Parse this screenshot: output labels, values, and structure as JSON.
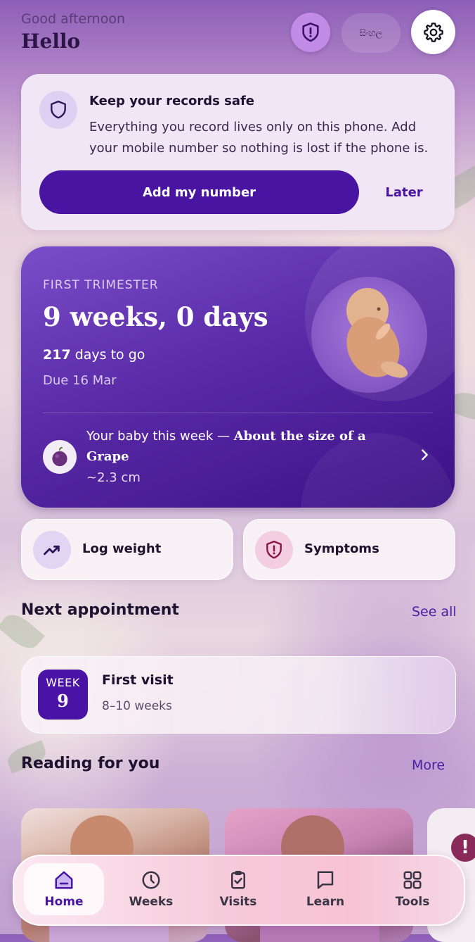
{
  "header": {
    "greeting": "Good afternoon",
    "title": "Hello",
    "language_label": "සිංහල"
  },
  "safe_card": {
    "title": "Keep your records safe",
    "text": "Everything you record lives only on this phone. Add your mobile number so nothing is lost if the phone is.",
    "primary_button": "Add my number",
    "secondary_button": "Later"
  },
  "pregnancy": {
    "trimester": "FIRST TRIMESTER",
    "progress": "9 weeks, 0 days",
    "days_to_go_number": "217",
    "days_to_go_text": "days to go",
    "due": "Due 16 Mar",
    "baby_week_prefix": "Your baby this week — ",
    "baby_week_size": "About the size of a Grape",
    "size_cm": "~2.3 cm"
  },
  "quick_actions": [
    {
      "label": "Log weight",
      "icon": "trend-up-icon"
    },
    {
      "label": "Symptoms",
      "icon": "shield-alert-icon"
    }
  ],
  "next_appointment": {
    "section_title": "Next appointment",
    "link": "See all",
    "badge_label": "WEEK",
    "badge_number": "9",
    "title": "First visit",
    "range": "8–10 weeks"
  },
  "reading": {
    "section_title": "Reading for you",
    "link": "More"
  },
  "bottom_nav": [
    {
      "label": "Home",
      "icon": "home-icon",
      "active": true
    },
    {
      "label": "Weeks",
      "icon": "clock-icon",
      "active": false
    },
    {
      "label": "Visits",
      "icon": "clipboard-check-icon",
      "active": false
    },
    {
      "label": "Learn",
      "icon": "chat-bubble-icon",
      "active": false
    },
    {
      "label": "Tools",
      "icon": "grid-icon",
      "active": false
    }
  ],
  "colors": {
    "brand_primary": "#4a14a3",
    "card_purple": "#5a2aa7",
    "accent_pink": "#f6c9d9"
  }
}
